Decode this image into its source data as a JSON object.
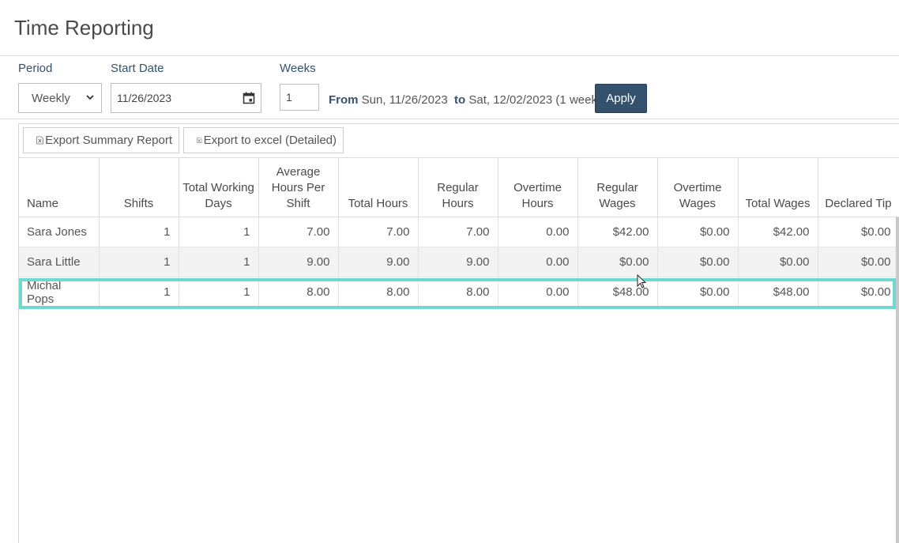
{
  "page": {
    "title": "Time Reporting"
  },
  "filters": {
    "period_label": "Period",
    "period_value": "Weekly",
    "start_date_label": "Start Date",
    "start_date_value": "11/26/2023",
    "weeks_label": "Weeks",
    "weeks_value": "1",
    "from_label": "From",
    "from_value": "Sun, 11/26/2023",
    "to_label": "to",
    "to_value": "Sat, 12/02/2023 (1 week)",
    "apply_label": "Apply"
  },
  "toolbar": {
    "export_summary_label": "Export Summary Report",
    "export_excel_label": "Export to excel (Detailed)"
  },
  "table": {
    "headers": [
      "Name",
      "Shifts",
      "Total Working Days",
      "Average Hours Per Shift",
      "Total Hours",
      "Regular Hours",
      "Overtime Hours",
      "Regular Wages",
      "Overtime Wages",
      "Total Wages",
      "Declared Tip"
    ],
    "rows": [
      [
        "Sara Jones",
        "1",
        "1",
        "7.00",
        "7.00",
        "7.00",
        "0.00",
        "$42.00",
        "$0.00",
        "$42.00",
        "$0.00"
      ],
      [
        "Sara Little",
        "1",
        "1",
        "9.00",
        "9.00",
        "9.00",
        "0.00",
        "$0.00",
        "$0.00",
        "$0.00",
        "$0.00"
      ],
      [
        "Michal Pops",
        "1",
        "1",
        "8.00",
        "8.00",
        "8.00",
        "0.00",
        "$48.00",
        "$0.00",
        "$48.00",
        "$0.00"
      ]
    ],
    "highlighted_row": 2
  },
  "colors": {
    "accent": "#34516e",
    "highlight": "#6fd8d2"
  },
  "icons": {
    "period_dropdown": "chevron-down-icon",
    "date_picker": "calendar-icon",
    "export": "excel-file-icon",
    "pointer": "mouse-cursor-icon"
  }
}
